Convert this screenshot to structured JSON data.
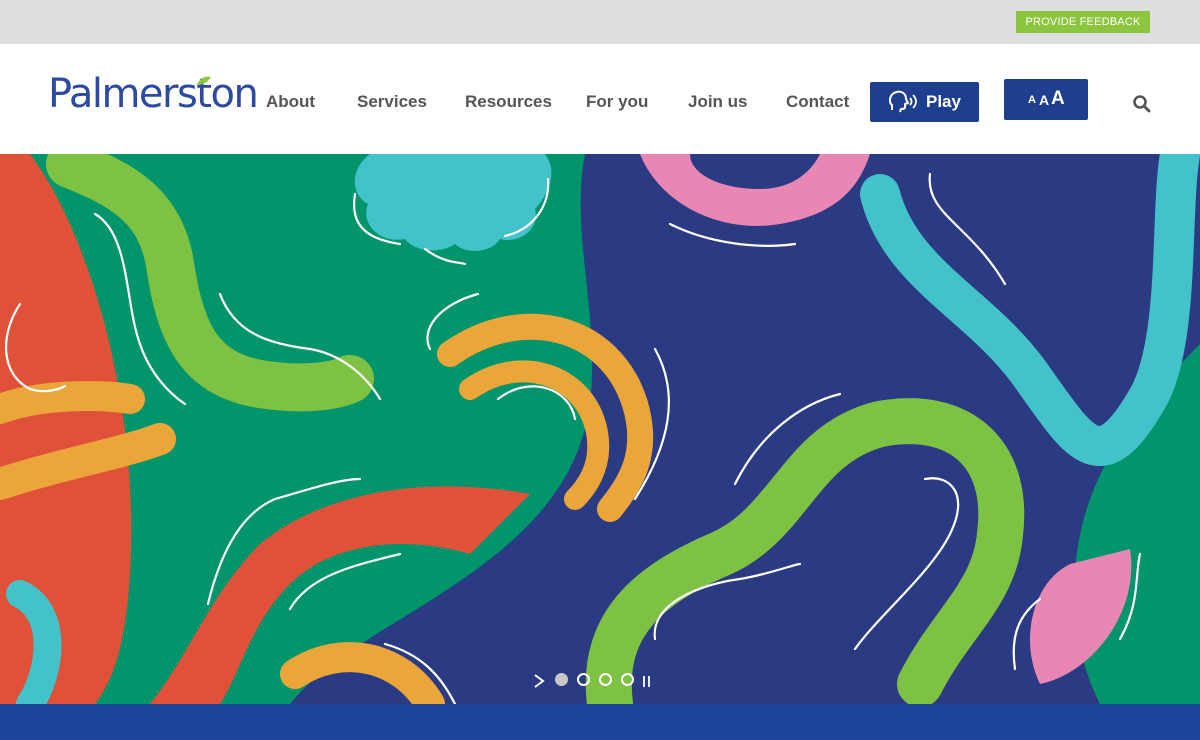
{
  "topbar": {
    "feedback_label": "PROVIDE FEEDBACK"
  },
  "header": {
    "logo_text": "Palmerston",
    "nav": [
      {
        "label": "About"
      },
      {
        "label": "Services"
      },
      {
        "label": "Resources"
      },
      {
        "label": "For you"
      },
      {
        "label": "Join us"
      },
      {
        "label": "Contact"
      }
    ],
    "play_label": "Play",
    "text_size_labels": [
      "A",
      "A",
      "A"
    ]
  },
  "slider": {
    "slide_count": 4,
    "active_slide": 1
  },
  "colors": {
    "brand_blue": "#1e3f8f",
    "feedback_green": "#8cc63f",
    "nav_text": "#555555"
  }
}
